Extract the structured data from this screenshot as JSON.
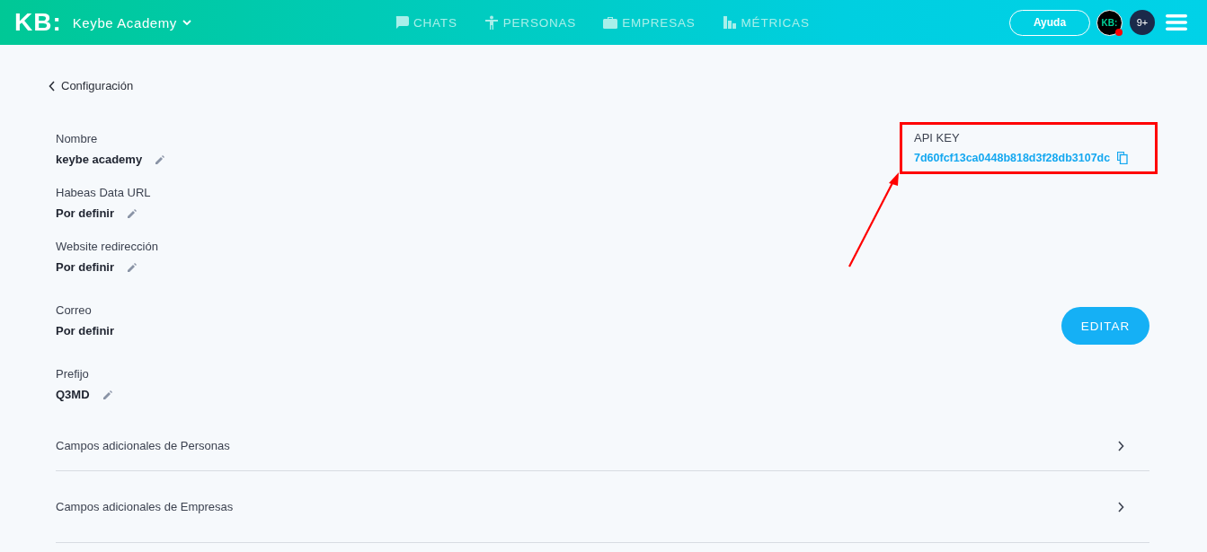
{
  "header": {
    "logo": "KB:",
    "workspace": "Keybe Academy",
    "nav": [
      {
        "kind": "chat",
        "label": "CHATS"
      },
      {
        "kind": "person",
        "label": "PERSONAS"
      },
      {
        "kind": "briefcase",
        "label": "EMPRESAS"
      },
      {
        "kind": "chart",
        "label": "MÉTRICAS"
      }
    ],
    "help_button": "Ayuda",
    "avatar": "KB:",
    "avatar_alert": true,
    "notifications": "9+"
  },
  "back_link": "Configuración",
  "fields": [
    {
      "label": "Nombre",
      "value": "keybe academy",
      "editable": true
    },
    {
      "label": "Habeas Data URL",
      "value": "Por definir",
      "editable": true
    },
    {
      "label": "Website redirección",
      "value": "Por definir",
      "editable": true
    },
    {
      "label": "Correo",
      "value": "Por definir",
      "editable": false
    },
    {
      "label": "Prefijo",
      "value": "Q3MD",
      "editable": true
    }
  ],
  "api_key": {
    "label": "API KEY",
    "value": "7d60fcf13ca0448b818d3f28db3107dc"
  },
  "edit_button": "EDITAR",
  "sections": [
    "Campos adicionales de Personas",
    "Campos adicionales de Empresas"
  ]
}
